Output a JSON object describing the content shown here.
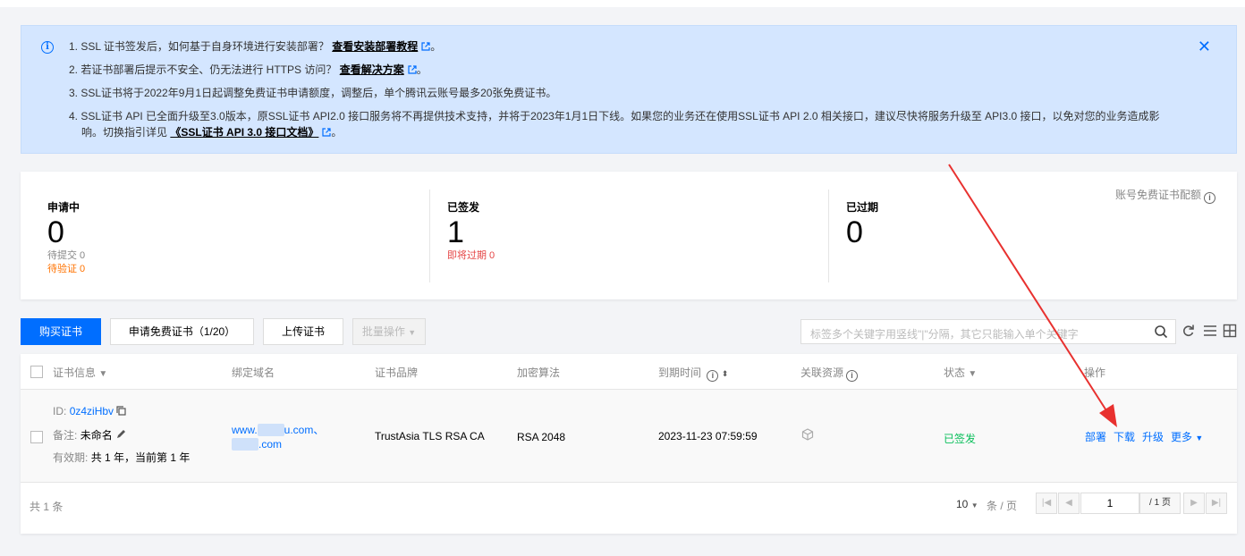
{
  "notice": {
    "items": [
      {
        "text": "1. SSL 证书签发后，如何基于自身环境进行安装部署？",
        "link": "查看安装部署教程",
        "suffix": "。"
      },
      {
        "text": "2. 若证书部署后提示不安全、仍无法进行 HTTPS 访问？",
        "link": "查看解决方案",
        "suffix": "。"
      },
      {
        "text": "3. SSL证书将于2022年9月1日起调整免费证书申请额度，调整后，单个腾讯云账号最多20张免费证书。"
      },
      {
        "text": "4. SSL证书 API 已全面升级至3.0版本，原SSL证书 API2.0 接口服务将不再提供技术支持，并将于2023年1月1日下线。如果您的业务还在使用SSL证书 API 2.0 相关接口，建议尽快将服务升级至 API3.0 接口，以免对您的业务造成影"
      },
      {
        "text": "响。切换指引详见",
        "link": "《SSL证书 API 3.0 接口文档》",
        "suffix": "。"
      }
    ]
  },
  "stats": {
    "applying": {
      "label": "申请中",
      "value": "0",
      "sub1": "待提交 0",
      "sub2": "待验证 0"
    },
    "issued": {
      "label": "已签发",
      "value": "1",
      "sub1": "即将过期 0"
    },
    "expired": {
      "label": "已过期",
      "value": "0"
    },
    "quota_label": "账号免费证书配额"
  },
  "toolbar": {
    "buy": "购买证书",
    "apply_free": "申请免费证书（1/20）",
    "upload": "上传证书",
    "batch": "批量操作",
    "search_placeholder": "标签多个关键字用竖线\"|\"分隔，其它只能输入单个关键字"
  },
  "table": {
    "headers": {
      "info": "证书信息",
      "domain": "绑定域名",
      "brand": "证书品牌",
      "algo": "加密算法",
      "expire": "到期时间",
      "resource": "关联资源",
      "status": "状态",
      "ops": "操作"
    },
    "row": {
      "id_label": "ID:",
      "id": "0z4ziHbv",
      "note_label": "备注:",
      "note": "未命名",
      "validity_label": "有效期:",
      "validity": "共 1 年，当前第 1 年",
      "domain1_prefix": "www.",
      "domain1_suffix": "u.com、",
      "domain2_suffix": ".com",
      "brand": "TrustAsia TLS RSA CA",
      "algo": "RSA 2048",
      "expire": "2023-11-23 07:59:59",
      "status": "已签发",
      "ops": [
        "部署",
        "下载",
        "升级",
        "更多"
      ]
    },
    "footer": {
      "total": "共 1 条",
      "page_size": "10",
      "per_page": "条 / 页",
      "page": "1",
      "total_pages": "/ 1 页"
    }
  },
  "colors": {
    "accent": "#006eff",
    "success": "#0abf5b",
    "warn": "#ff7200",
    "danger": "#e54545",
    "annotation": "#e8312f"
  }
}
